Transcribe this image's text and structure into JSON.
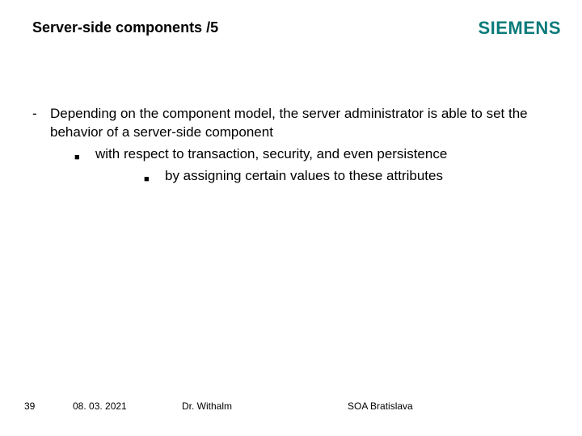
{
  "header": {
    "title": "Server-side components /5",
    "brand": "SIEMENS"
  },
  "content": {
    "level1": {
      "bullet": "-",
      "text": "Depending on the component model, the server administrator is able to set the behavior of a server-side component"
    },
    "level2": {
      "bullet": "■",
      "text": "with respect to transaction, security, and even persistence"
    },
    "level3": {
      "bullet": "■",
      "text": "by assigning certain values to these attributes"
    }
  },
  "footer": {
    "page": "39",
    "date": "08. 03. 2021",
    "author": "Dr. Withalm",
    "course": "SOA Bratislava"
  }
}
